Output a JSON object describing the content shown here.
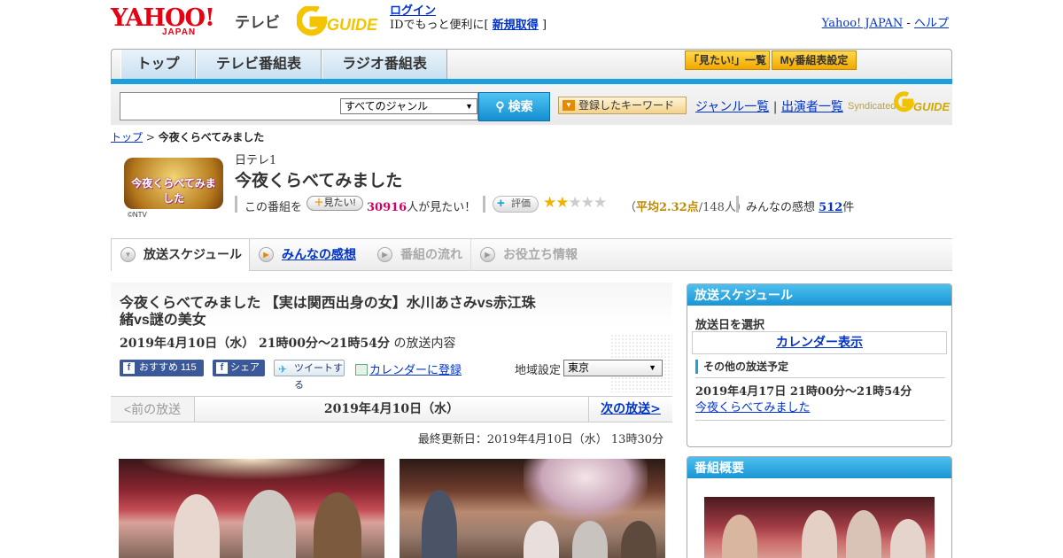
{
  "header": {
    "logo_yahoo": "YAHOO!",
    "logo_japan": "JAPAN",
    "logo_tv": "テレビ",
    "logo_gguide": "GUIDE",
    "login_link": "ログイン",
    "login_prefix": "IDでもっと便利に[",
    "signup_link": "新規取得",
    "login_suffix": "]",
    "yahoo_japan_link": "Yahoo! JAPAN",
    "sep": "-",
    "help_link": "ヘルプ"
  },
  "nav": {
    "tabs": [
      {
        "label": "トップ"
      },
      {
        "label": "テレビ番組表"
      },
      {
        "label": "ラジオ番組表"
      }
    ],
    "mitai_list": "「見たい!」一覧",
    "my_bangumi": "My番組表設定"
  },
  "search": {
    "query": "",
    "genre": "すべてのジャンル",
    "button": "検索",
    "keyword_button": "登録したキーワード",
    "genre_list_link": "ジャンル一覧",
    "divider": "|",
    "performer_list_link": "出演者一覧",
    "syndicated": "Syndicated",
    "syndicated_brand": "GUIDE"
  },
  "breadcrumb": {
    "top": "トップ",
    "sep": ">",
    "current": "今夜くらべてみました"
  },
  "program": {
    "logo_text": "今夜くらべてみました",
    "copyright": "©NTV",
    "channel": "日テレ1",
    "title": "今夜くらべてみました",
    "mitai_prefix": "この番組を",
    "mitai_button": "見たい!",
    "mitai_count": "30916",
    "mitai_suffix": "人が見たい！",
    "rating_button": "評価",
    "rating_stars": 2.32,
    "avg_open": "（",
    "avg_label": "平均2.32点",
    "avg_count": "/148人）",
    "kanso_label": "みんなの感想",
    "kanso_count": "512",
    "kanso_unit": "件"
  },
  "detail_tabs": [
    {
      "label": "放送スケジュール"
    },
    {
      "label": "みんなの感想"
    },
    {
      "label": "番組の流れ"
    },
    {
      "label": "お役立ち情報"
    }
  ],
  "episode": {
    "title": "今夜くらべてみました 【実は関西出身の女】水川あさみvs赤江珠緒vs謎の美女",
    "datetime": "2019年4月10日（水） 21時00分～21時54分",
    "datetime_suffix": "の放送内容",
    "fb_recommend": "おすすめ 115",
    "fb_share": "シェア",
    "tweet": "ツイートする",
    "calendar_register": "カレンダーに登録",
    "region_label": "地域設定",
    "region": "東京",
    "prev": "<前の放送",
    "nav_date": "2019年4月10日（水）",
    "next": "次の放送>",
    "last_update": "最終更新日：2019年4月10日（水） 13時30分"
  },
  "sidebar": {
    "schedule_title": "放送スケジュール",
    "select_date": "放送日を選択",
    "calendar": "カレンダー表示",
    "other_label": "その他の放送予定",
    "other_date": "2019年4月17日 21時00分～21時54分",
    "other_link": "今夜くらべてみました",
    "overview_title": "番組概要"
  },
  "icons": {
    "search": "search-icon",
    "facebook": "facebook-icon",
    "twitter": "twitter-icon",
    "calendar": "calendar-icon",
    "play": "play-circle-icon"
  },
  "colors": {
    "accent_blue": "#1aa0dc",
    "brand_red": "#e60012",
    "highlight_pink": "#d4006a",
    "star_gold": "#f1b200"
  }
}
